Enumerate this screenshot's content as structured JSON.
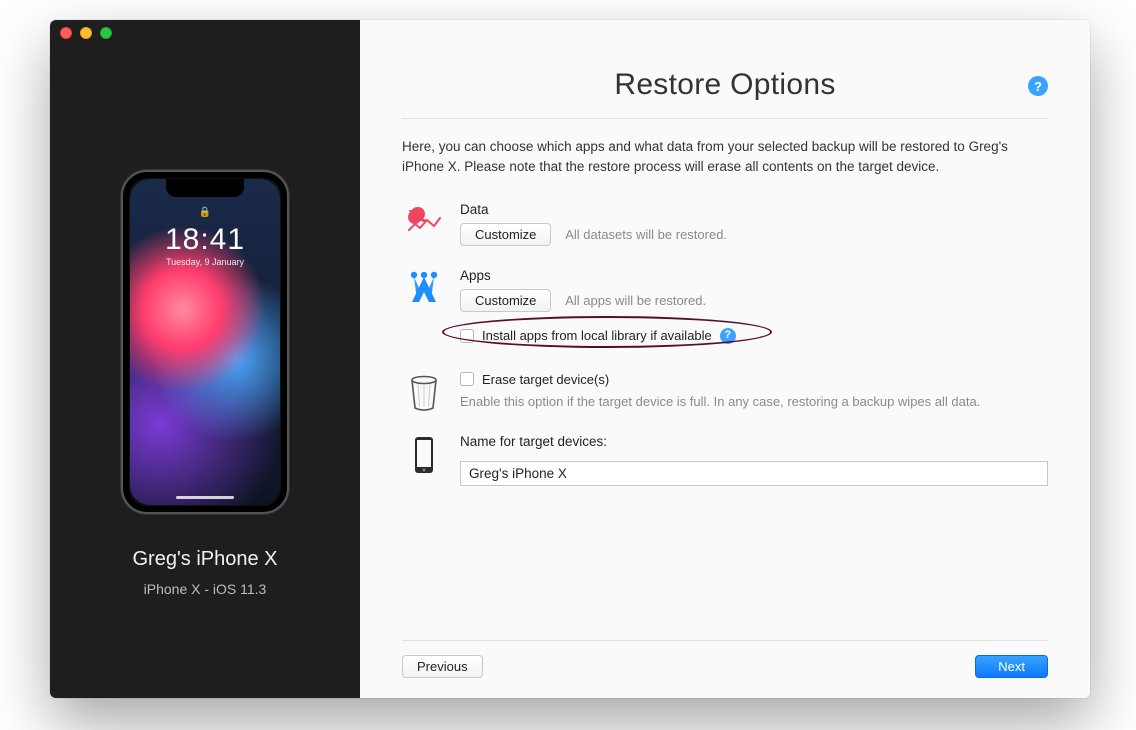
{
  "window": {
    "title": "Restore Options"
  },
  "sidebar": {
    "device_name": "Greg's iPhone X",
    "device_sub": "iPhone X - iOS 11.3",
    "lockscreen": {
      "time": "18:41",
      "date": "Tuesday, 9 January"
    }
  },
  "intro": "Here, you can choose which apps and what data from your selected backup will be restored to Greg's iPhone X. Please note that the restore process will erase all contents on the target device.",
  "sections": {
    "data": {
      "title": "Data",
      "customize_label": "Customize",
      "hint": "All datasets will be restored."
    },
    "apps": {
      "title": "Apps",
      "customize_label": "Customize",
      "hint": "All apps will be restored.",
      "local_install_label": "Install apps from local library if available"
    },
    "erase": {
      "label": "Erase target device(s)",
      "note": "Enable this option if the target device is full. In any case, restoring a backup wipes all data."
    },
    "name": {
      "label": "Name for target devices:",
      "value": "Greg's iPhone X"
    }
  },
  "footer": {
    "previous": "Previous",
    "next": "Next"
  },
  "glyphs": {
    "help": "?",
    "lock": "🔒"
  }
}
